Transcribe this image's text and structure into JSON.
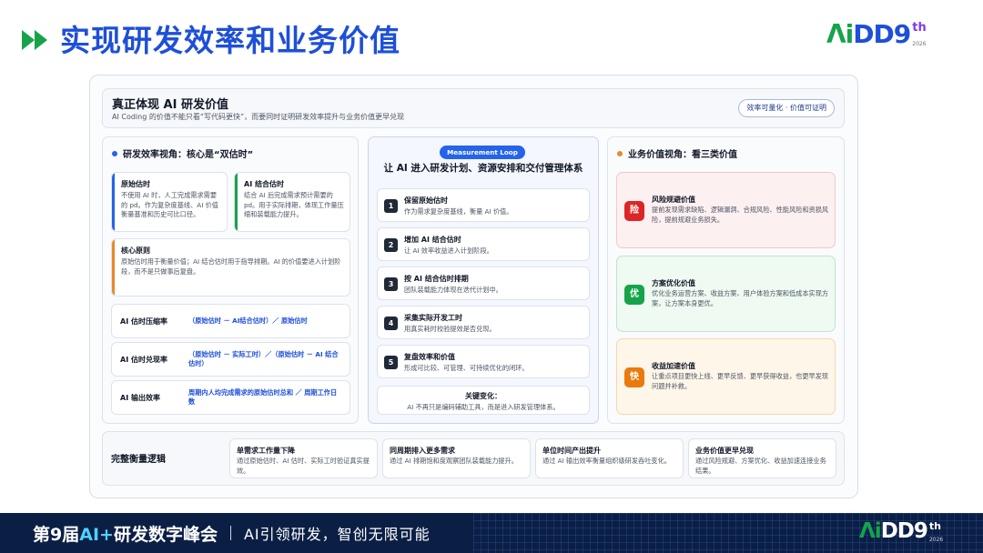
{
  "header": {
    "title": "实现研发效率和业务价值",
    "logo": {
      "letters_a": "Λi",
      "letters_b": "DD",
      "nine": "9",
      "sup": "th",
      "year": "2026"
    }
  },
  "summary": {
    "title": "真正体现 AI 研发价值",
    "subtitle": "AI Coding 的价值不能只看“写代码更快”，而要同时证明研发效率提升与业务价值更早兑现",
    "pill": "效率可量化 · 价值可证明"
  },
  "left": {
    "heading": "研发效率视角：核心是“双估时”",
    "estimates": [
      {
        "title": "原始估时",
        "desc": "不使用 AI 时，人工完成需求需要的 pd。作为复杂度基线、AI 价值衡量基准和历史可比口径。"
      },
      {
        "title": "AI 结合估时",
        "desc": "结合 AI 后完成需求预计需要的 pd。用于实际排期，体现工作量压缩和装载能力提升。"
      },
      {
        "title": "核心原则",
        "desc": "原始估时用于衡量价值；AI 结合估时用于指导排期。AI 的价值要进入计划阶段，而不是只做事后复盘。"
      }
    ],
    "formulas": [
      {
        "label": "AI 估时压缩率",
        "value": "（原始估时 － AI结合估时）／ 原始估时"
      },
      {
        "label": "AI 估时兑现率",
        "value": "（原始估时 － 实际工时）／（原始估时 － AI 结合估时）"
      },
      {
        "label": "AI 输出效率",
        "value": "周期内人均完成需求的原始估时总和 ／ 周期工作日数"
      }
    ]
  },
  "middle": {
    "badge": "Measurement Loop",
    "title": "让 AI 进入研发计划、资源安排和交付管理体系",
    "steps": [
      {
        "num": "1",
        "title": "保留原始估时",
        "desc": "作为需求复杂度基线，衡量 AI 价值。"
      },
      {
        "num": "2",
        "title": "增加 AI 结合估时",
        "desc": "让 AI 效率收益进入计划阶段。"
      },
      {
        "num": "3",
        "title": "按 AI 结合估时排期",
        "desc": "团队装载能力体现在迭代计划中。"
      },
      {
        "num": "4",
        "title": "采集实际开发工时",
        "desc": "用真实耗时校验提效是否兑现。"
      },
      {
        "num": "5",
        "title": "复盘效率和价值",
        "desc": "形成可比较、可管理、可持续优化的闭环。"
      }
    ],
    "key": {
      "title": "关键变化：",
      "desc": "AI 不再只是编码辅助工具，而是进入研发管理体系。"
    }
  },
  "right": {
    "heading": "业务价值视角：看三类价值",
    "values": [
      {
        "icon": "险",
        "title": "风险规避价值",
        "desc": "提前发现需求缺陷、逻辑漏洞、合规风险、性能风险和资损风险，提前规避业务损失。",
        "bg": "#fdf0f0",
        "border": "#f3c9c9",
        "icon_bg": "#dc2626"
      },
      {
        "icon": "优",
        "title": "方案优化价值",
        "desc": "优化业务运营方案、收益方案、用户体验方案和低成本实现方案，让方案本身更优。",
        "bg": "#effaf2",
        "border": "#bfe5cb",
        "icon_bg": "#16a34a"
      },
      {
        "icon": "快",
        "title": "收益加速价值",
        "desc": "让重点项目更快上线、更早反馈、更早获得收益，也更早发现问题并补救。",
        "bg": "#fff6ea",
        "border": "#f4d7ad",
        "icon_bg": "#ea7a0c"
      }
    ]
  },
  "bottom": {
    "label": "完整衡量逻辑",
    "cards": [
      {
        "title": "单需求工作量下降",
        "desc": "通过原始估时、AI 估时、实际工时验证真实提效。"
      },
      {
        "title": "同周期排入更多需求",
        "desc": "通过 AI 排期饱和度观察团队装载能力提升。"
      },
      {
        "title": "单位时间产出提升",
        "desc": "通过 AI 输出效率衡量组织级研发吞吐变化。"
      },
      {
        "title": "业务价值更早兑现",
        "desc": "通过风险规避、方案优化、收益加速连接业务结果。"
      }
    ]
  },
  "footer": {
    "main_a": "第9届",
    "main_b": "AI+",
    "main_c": "研发数字峰会",
    "slogan": "AI引领研发，智创无限可能"
  },
  "colors": {
    "brand_blue": "#1e4fd8",
    "brand_green": "#16a34a",
    "accent_orange": "#e8892b"
  }
}
